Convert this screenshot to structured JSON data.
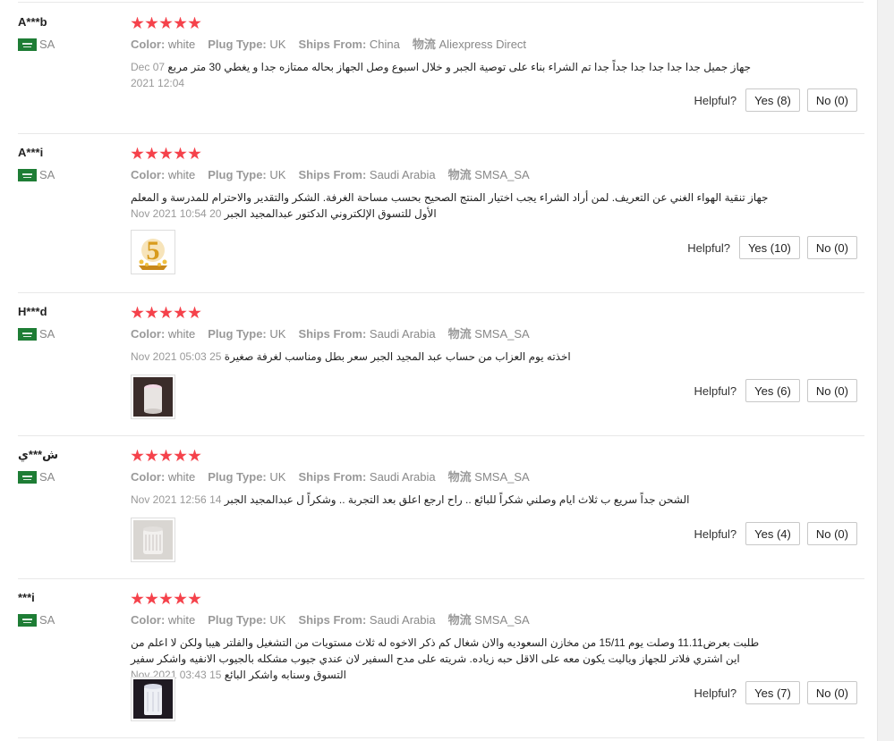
{
  "labels": {
    "color": "Color:",
    "plug_type": "Plug Type:",
    "ships_from": "Ships From:",
    "logistics": "物流",
    "helpful": "Helpful?"
  },
  "colors": {
    "star": "#f5424b",
    "flag": "#1e7d35"
  },
  "reviews": [
    {
      "user": "A***b",
      "country": "SA",
      "stars": 5,
      "color": "white",
      "plug_type": "UK",
      "ships_from": "China",
      "logistics": "Aliexpress Direct",
      "text": "جهاز جميل جدا جدا جدا جدا جداً جدا تم الشراء بناء على توصية الجبر و خلال اسبوع وصل الجهاز بحاله ممتازه جدا و يغطي 30 متر مربع",
      "text2": "",
      "date": "07 Dec 2021 12:04",
      "image": "",
      "yes": "Yes (8)",
      "no": "No (0)"
    },
    {
      "user": "A***i",
      "country": "SA",
      "stars": 5,
      "color": "white",
      "plug_type": "UK",
      "ships_from": "Saudi Arabia",
      "logistics": "SMSA_SA",
      "text": "جهاز تنقية الهواء الغني عن التعريف. لمن أراد الشراء يجب اختيار المنتج الصحيح بحسب مساحة الغرفة. الشكر والتقدير والاحترام للمدرسة و المعلم الأول للتسوق الإلكتروني",
      "text2": "الدكتور عبدالمجيد الجبر",
      "date": "20 Nov 2021 10:54",
      "image": "badge-5-stars",
      "yes": "Yes (10)",
      "no": "No (0)"
    },
    {
      "user": "H***d",
      "country": "SA",
      "stars": 5,
      "color": "white",
      "plug_type": "UK",
      "ships_from": "Saudi Arabia",
      "logistics": "SMSA_SA",
      "text": "اخذته يوم العزاب من حساب عبد المجيد الجبر سعر بطل ومناسب لغرفة صغيرة",
      "text2": "",
      "date": "25 Nov 2021 05:03",
      "image": "purifier-lit",
      "yes": "Yes (6)",
      "no": "No (0)"
    },
    {
      "user": "ش***ي",
      "country": "SA",
      "stars": 5,
      "color": "white",
      "plug_type": "UK",
      "ships_from": "Saudi Arabia",
      "logistics": "SMSA_SA",
      "text": "الشحن جداً سريع ب ثلاث ايام وصلني شكراً للبائع .. راح ارجع اعلق بعد التجربة .. وشكراً ل عبدالمجيد الجبر",
      "text2": "",
      "date": "14 Nov 2021 12:56",
      "image": "purifier-white",
      "yes": "Yes (4)",
      "no": "No (0)"
    },
    {
      "user": "***i",
      "country": "SA",
      "stars": 5,
      "color": "white",
      "plug_type": "UK",
      "ships_from": "Saudi Arabia",
      "logistics": "SMSA_SA",
      "text": "طلبت بعرض11.11 وصلت يوم 15/11 من مخازن السعوديه والان شغال كم ذكر الاخوه له ثلاث مستويات من التشغيل والفلتر هيبا ولكن لا اعلم من اين اشتري فلاتر للجهاز",
      "text2": "وياليت يكون معه على الاقل حبه زياده. شريته على مدح السفير لان عندي جيوب مشكله بالجيوب الانفيه واشكر سفير التسوق وسنابه واشكر البائع",
      "date": "15 Nov 2021 03:43",
      "image": "purifier-dark",
      "yes": "Yes (7)",
      "no": "No (0)"
    }
  ]
}
